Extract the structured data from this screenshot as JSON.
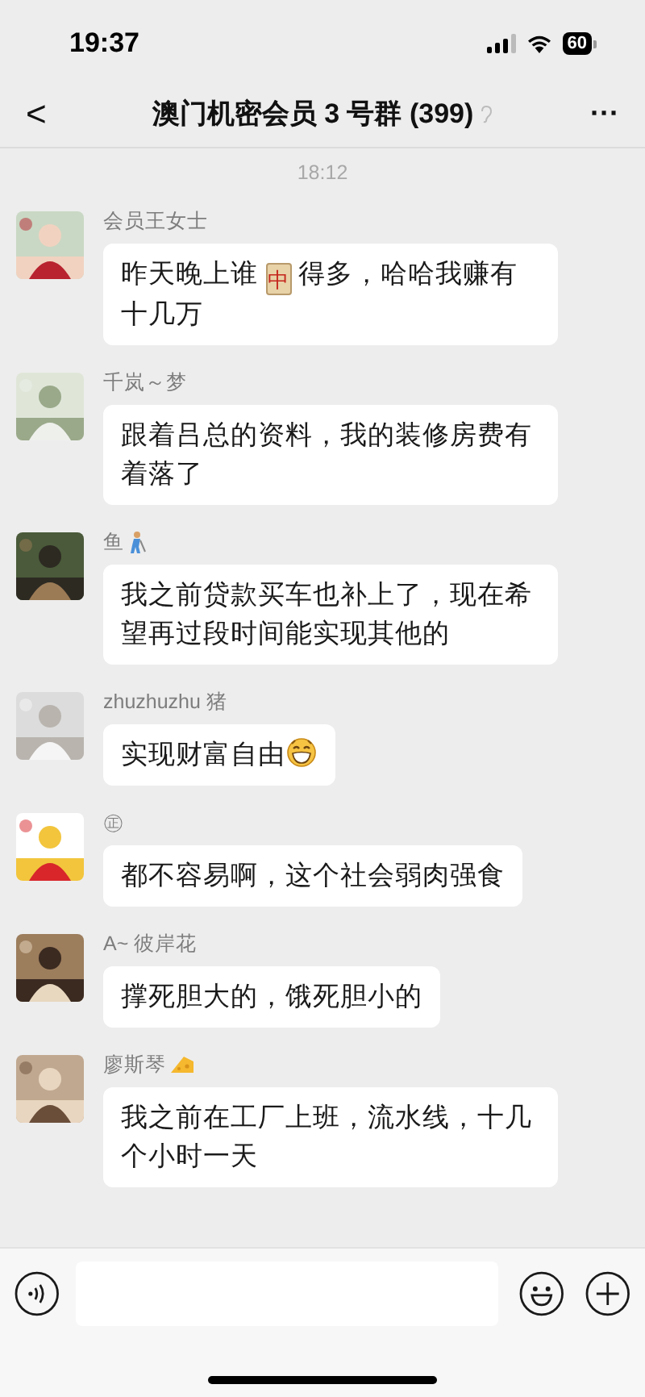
{
  "status_bar": {
    "time": "19:37",
    "battery": "60"
  },
  "nav": {
    "back": "<",
    "title": "澳门机密会员 3 号群 (399)",
    "more": "···"
  },
  "timestamp": "18:12",
  "messages": [
    {
      "name": "会员王女士",
      "parts": [
        {
          "kind": "text",
          "text": "昨天晚上谁 "
        },
        {
          "kind": "tile",
          "text": "中"
        },
        {
          "kind": "text",
          "text": " 得多，哈哈我赚有十几万"
        }
      ]
    },
    {
      "name": "千岚～梦",
      "parts": [
        {
          "kind": "text",
          "text": "跟着吕总的资料，我的装修房费有着落了"
        }
      ]
    },
    {
      "name": "鱼",
      "badge": {
        "kind": "golfer"
      },
      "parts": [
        {
          "kind": "text",
          "text": "我之前贷款买车也补上了，现在希望再过段时间能实现其他的"
        }
      ]
    },
    {
      "name": "zhuzhuzhu 猪",
      "parts": [
        {
          "kind": "text",
          "text": "实现财富自由"
        },
        {
          "kind": "grin"
        }
      ]
    },
    {
      "name": "㊣",
      "parts": [
        {
          "kind": "text",
          "text": "都不容易啊，这个社会弱肉强食"
        }
      ]
    },
    {
      "name": "A~ 彼岸花",
      "parts": [
        {
          "kind": "text",
          "text": "撑死胆大的，饿死胆小的"
        }
      ]
    },
    {
      "name": "廖斯琴",
      "badge": {
        "kind": "cheese"
      },
      "parts": [
        {
          "kind": "text",
          "text": "我之前在工厂上班，流水线，十几个小时一天"
        }
      ]
    }
  ]
}
